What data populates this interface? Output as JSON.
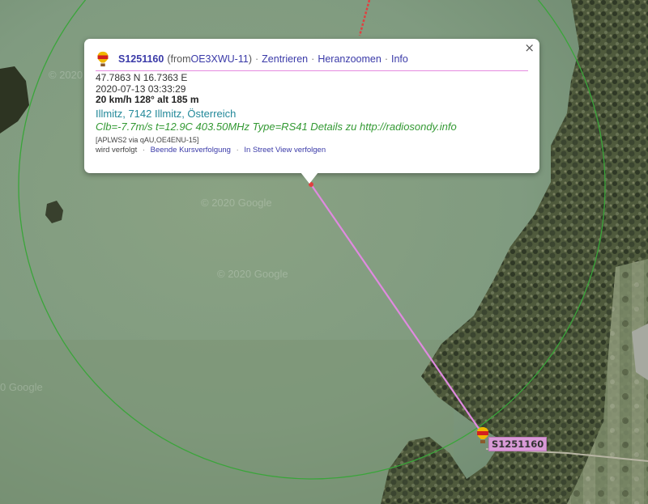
{
  "map": {
    "watermark_text": "© 2020 Google",
    "watermark_partial": "0 Google",
    "track_color": "#e08ae0",
    "range_circle_color": "#3aa53a"
  },
  "popup": {
    "callsign": "S1251160",
    "from_prefix": "(from ",
    "from_call": "OE3XWU-11",
    "from_suffix": ")",
    "separator": "·",
    "links": [
      "Zentrieren",
      "Heranzoomen",
      "Info"
    ],
    "coords": "47.7863 N 16.7363 E",
    "timestamp": "2020-07-13 03:33:29",
    "motion": "20 km/h 128° alt 185 m",
    "address": "Illmitz, 7142 Illmitz, Österreich",
    "comment_text": "Clb=-7.7m/s t=12.9C 403.50MHz Type=RS41 Details zu ",
    "comment_link": "http://radiosondy.info",
    "path": "[APLWS2 via qAU,OE4ENU-15]",
    "status_prefix": "wird verfolgt",
    "actions": [
      "Beende Kursverfolgung",
      "In Street View verfolgen"
    ],
    "close_glyph": "×"
  },
  "marker": {
    "label": "S1251160",
    "icon": "balloon-icon"
  }
}
